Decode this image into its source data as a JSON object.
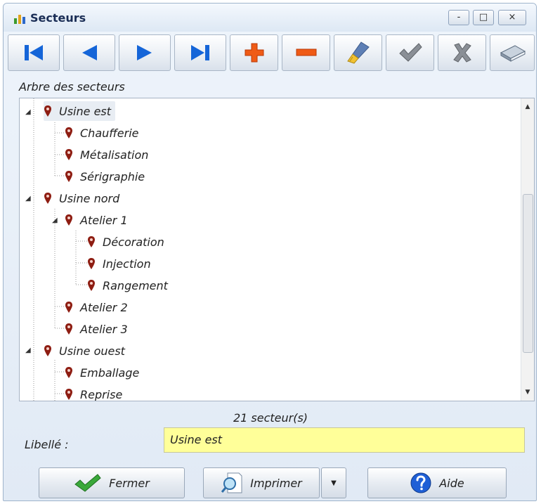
{
  "window": {
    "title": "Secteurs"
  },
  "window_controls": {
    "minimize": "-",
    "maximize": "□",
    "close": "×"
  },
  "section_label": "Arbre des secteurs",
  "tree": [
    {
      "label": "Usine est",
      "level": 0,
      "expanded": true,
      "selected": true
    },
    {
      "label": "Chaufferie",
      "level": 1
    },
    {
      "label": "Métalisation",
      "level": 1
    },
    {
      "label": "Sérigraphie",
      "level": 1
    },
    {
      "label": "Usine nord",
      "level": 0,
      "expanded": true
    },
    {
      "label": "Atelier 1",
      "level": 1,
      "expanded": true
    },
    {
      "label": "Décoration",
      "level": 2
    },
    {
      "label": "Injection",
      "level": 2
    },
    {
      "label": "Rangement",
      "level": 2
    },
    {
      "label": "Atelier 2",
      "level": 1
    },
    {
      "label": "Atelier 3",
      "level": 1
    },
    {
      "label": "Usine ouest",
      "level": 0,
      "expanded": true
    },
    {
      "label": "Emballage",
      "level": 1
    },
    {
      "label": "Reprise",
      "level": 1
    }
  ],
  "count_text": "21  secteur(s)",
  "libelle": {
    "label": "Libellé :",
    "value": "Usine est"
  },
  "buttons": {
    "fermer": "Fermer",
    "imprimer": "Imprimer",
    "aide": "Aide"
  },
  "colors": {
    "pin": "#8e1d12",
    "field_bg": "#ffff99",
    "nav_blue": "#1565d8",
    "add_orange": "#ef5b16"
  },
  "toolbar_icons": [
    "first-icon",
    "previous-icon",
    "next-icon",
    "last-icon",
    "add-icon",
    "remove-icon",
    "clean-icon",
    "validate-icon",
    "cancel-icon",
    "book-icon"
  ]
}
